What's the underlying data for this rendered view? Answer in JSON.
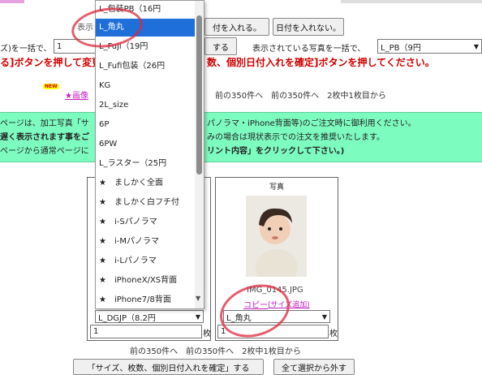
{
  "top": {
    "date_on_button": "付を入れる。",
    "date_off_button": "日付を入れない。",
    "show_label": "表示",
    "bulk_label_left": "ズ)を一括で、",
    "qty_value": "1",
    "do_button": "する",
    "bulk_label_right": "表示されている写真を一括で、",
    "right_select_value": "L_PB（9円",
    "instruction_left": "る]ボタンを押して変更",
    "instruction_right": "数、個別日付入れを確定]ボタンを押してください。",
    "new_badge": "NEW",
    "image_link": "★画像",
    "pager_top": "前の350件へ　前の350件へ　2枚中1枚目から"
  },
  "notice": {
    "line1_prefix": "ページは、加工写真「サ",
    "line1_suffix": "パノラマ・iPhone背面等)のご注文時に御利用ください。",
    "line2_prefix": "遅く表示されます事をご",
    "line2_suffix": "みの場合は現状表示での注文を推奨いたします。",
    "line3_prefix": "ページから通常ページに",
    "line3_suffix": "リント内容」をクリックして下さい。)"
  },
  "dropdown": {
    "items": [
      "L_包装PB（16円",
      "L_角丸",
      "L_Fuji（19円",
      "L_Fufi包装（26円",
      "KG",
      "2L_size",
      "6P",
      "6PW",
      "L_ラスター（25円",
      "★　ましかく全面",
      "★　ましかく白フチ付",
      "★　i-Sパノラマ",
      "★　i-Mパノラマ",
      "★　i-Lパノラマ",
      "★　iPhoneX/XS背面",
      "★　iPhone7/8背面"
    ],
    "selected_index": 1
  },
  "cards": {
    "left": {
      "size_select": "L_DGJP（8.2円",
      "qty": "1",
      "qty_unit": "枚"
    },
    "right": {
      "header": "写真",
      "filename": "IMG_0145.JPG",
      "copy_link": "コピー",
      "size_add_link": "(サイズ追加)",
      "size_select": "L_角丸",
      "qty": "1",
      "qty_unit": "枚"
    }
  },
  "pager_bottom": "前の350件へ　前の350件へ　2枚中1枚目から",
  "bottom": {
    "confirm_button": "「サイズ、枚数、個別日付入れを確定」する",
    "deselect_button": "全て選択から外す"
  },
  "colors": {
    "notice_bg": "#7dfcc0",
    "selected_bg": "#1e6fd9",
    "alert_red": "#d00000",
    "link_pink": "#c020c0",
    "annotation_red": "#dc283c"
  },
  "icons": {
    "dropdown_arrow": "chevron-down-icon"
  }
}
